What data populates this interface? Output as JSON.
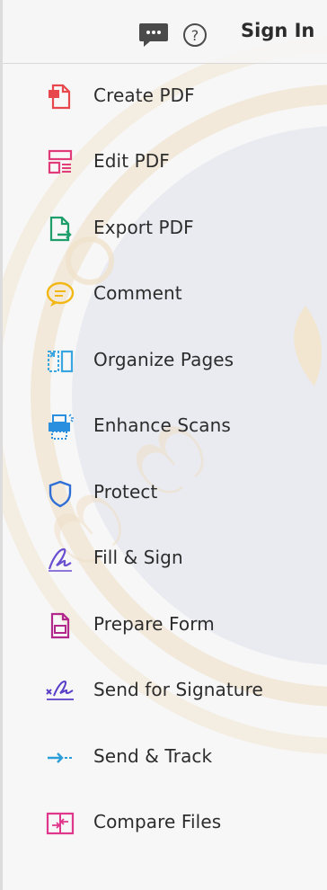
{
  "header": {
    "sign_in_label": "Sign In",
    "icons": [
      "chat-icon",
      "help-icon"
    ]
  },
  "tools": [
    {
      "label": "Create PDF",
      "icon": "create-pdf-icon",
      "color": "#e8484b"
    },
    {
      "label": "Edit PDF",
      "icon": "edit-pdf-icon",
      "color": "#e23b7a"
    },
    {
      "label": "Export PDF",
      "icon": "export-pdf-icon",
      "color": "#1e9e6a"
    },
    {
      "label": "Comment",
      "icon": "comment-icon",
      "color": "#f2b713"
    },
    {
      "label": "Organize Pages",
      "icon": "organize-pages-icon",
      "color": "#39a6e2"
    },
    {
      "label": "Enhance Scans",
      "icon": "enhance-scans-icon",
      "color": "#2b8fe0"
    },
    {
      "label": "Protect",
      "icon": "protect-icon",
      "color": "#2f6fd6"
    },
    {
      "label": "Fill & Sign",
      "icon": "fill-sign-icon",
      "color": "#6a4fd1"
    },
    {
      "label": "Prepare Form",
      "icon": "prepare-form-icon",
      "color": "#b2288a"
    },
    {
      "label": "Send for Signature",
      "icon": "send-for-signature-icon",
      "color": "#5a3ec8"
    },
    {
      "label": "Send & Track",
      "icon": "send-track-icon",
      "color": "#2a9ed8"
    },
    {
      "label": "Compare Files",
      "icon": "compare-files-icon",
      "color": "#e0368b"
    }
  ]
}
